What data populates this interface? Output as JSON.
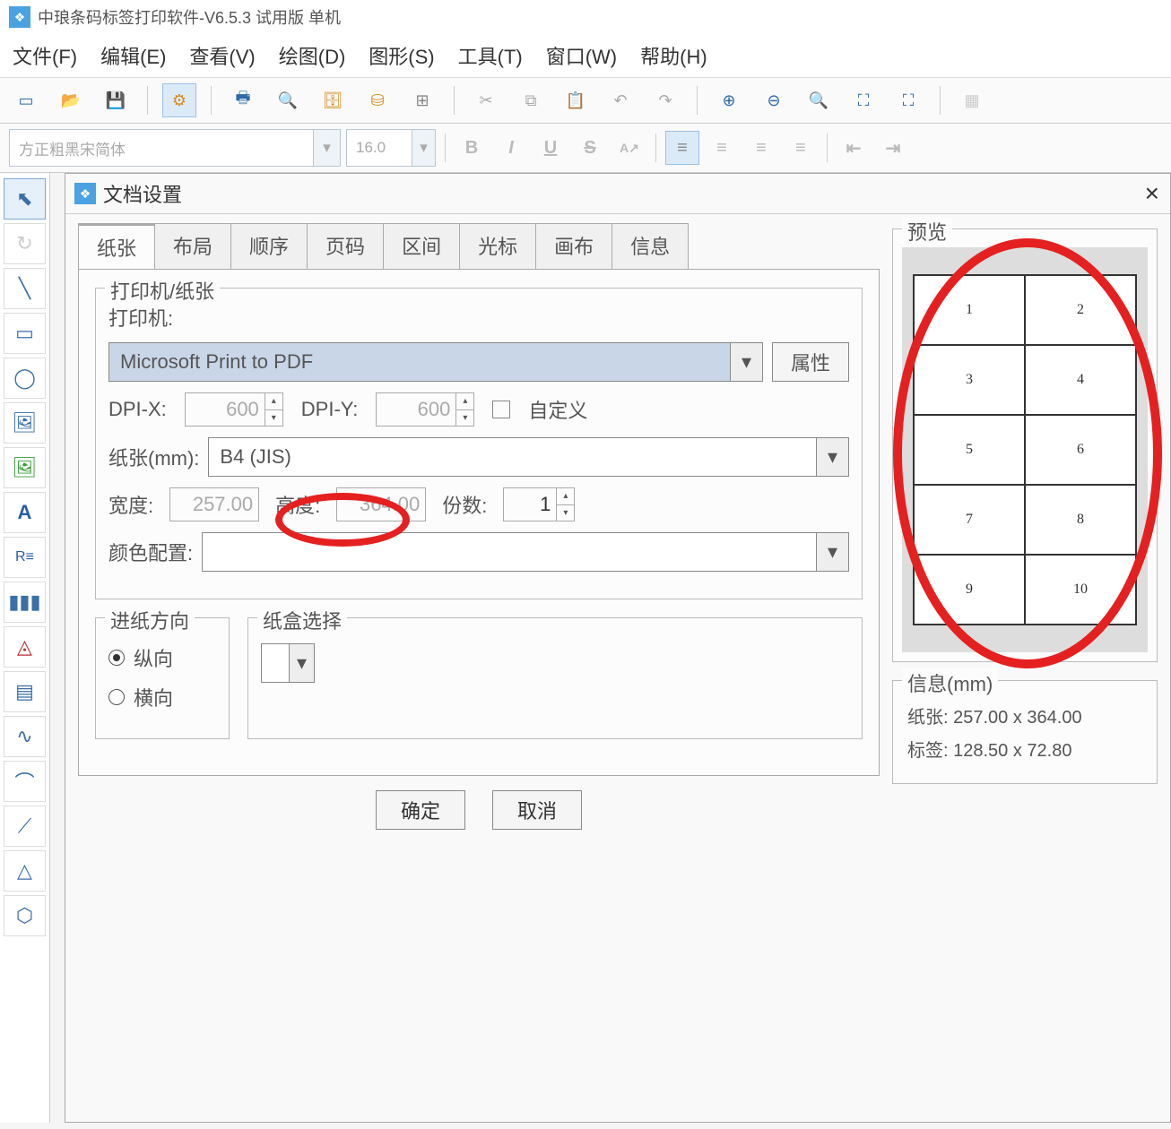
{
  "titlebar": {
    "text": "中琅条码标签打印软件-V6.5.3 试用版 单机"
  },
  "menu": {
    "file": "文件(F)",
    "edit": "编辑(E)",
    "view": "查看(V)",
    "draw": "绘图(D)",
    "shape": "图形(S)",
    "tool": "工具(T)",
    "window": "窗口(W)",
    "help": "帮助(H)"
  },
  "formatbar": {
    "font_placeholder": "方正粗黑宋简体",
    "size_placeholder": "16.0"
  },
  "dialog": {
    "title": "文档设置",
    "tabs": [
      "纸张",
      "布局",
      "顺序",
      "页码",
      "区间",
      "光标",
      "画布",
      "信息"
    ],
    "printer_section": "打印机/纸张",
    "printer_label": "打印机:",
    "printer_value": "Microsoft Print to PDF",
    "properties_btn": "属性",
    "dpi_x_label": "DPI-X:",
    "dpi_x_value": "600",
    "dpi_y_label": "DPI-Y:",
    "dpi_y_value": "600",
    "custom_label": "自定义",
    "paper_label": "纸张(mm):",
    "paper_value": "B4 (JIS)",
    "width_label": "宽度:",
    "width_value": "257.00",
    "height_label": "高度:",
    "height_value": "364.00",
    "copies_label": "份数:",
    "copies_value": "1",
    "color_label": "颜色配置:",
    "feed_section": "进纸方向",
    "portrait": "纵向",
    "landscape": "横向",
    "tray_section": "纸盒选择",
    "ok": "确定",
    "cancel": "取消"
  },
  "preview": {
    "title": "预览",
    "cells": [
      "1",
      "2",
      "3",
      "4",
      "5",
      "6",
      "7",
      "8",
      "9",
      "10"
    ]
  },
  "info": {
    "title": "信息(mm)",
    "paper_label": "纸张:",
    "paper_value": "257.00 x 364.00",
    "label_label": "标签:",
    "label_value": "128.50 x 72.80"
  }
}
